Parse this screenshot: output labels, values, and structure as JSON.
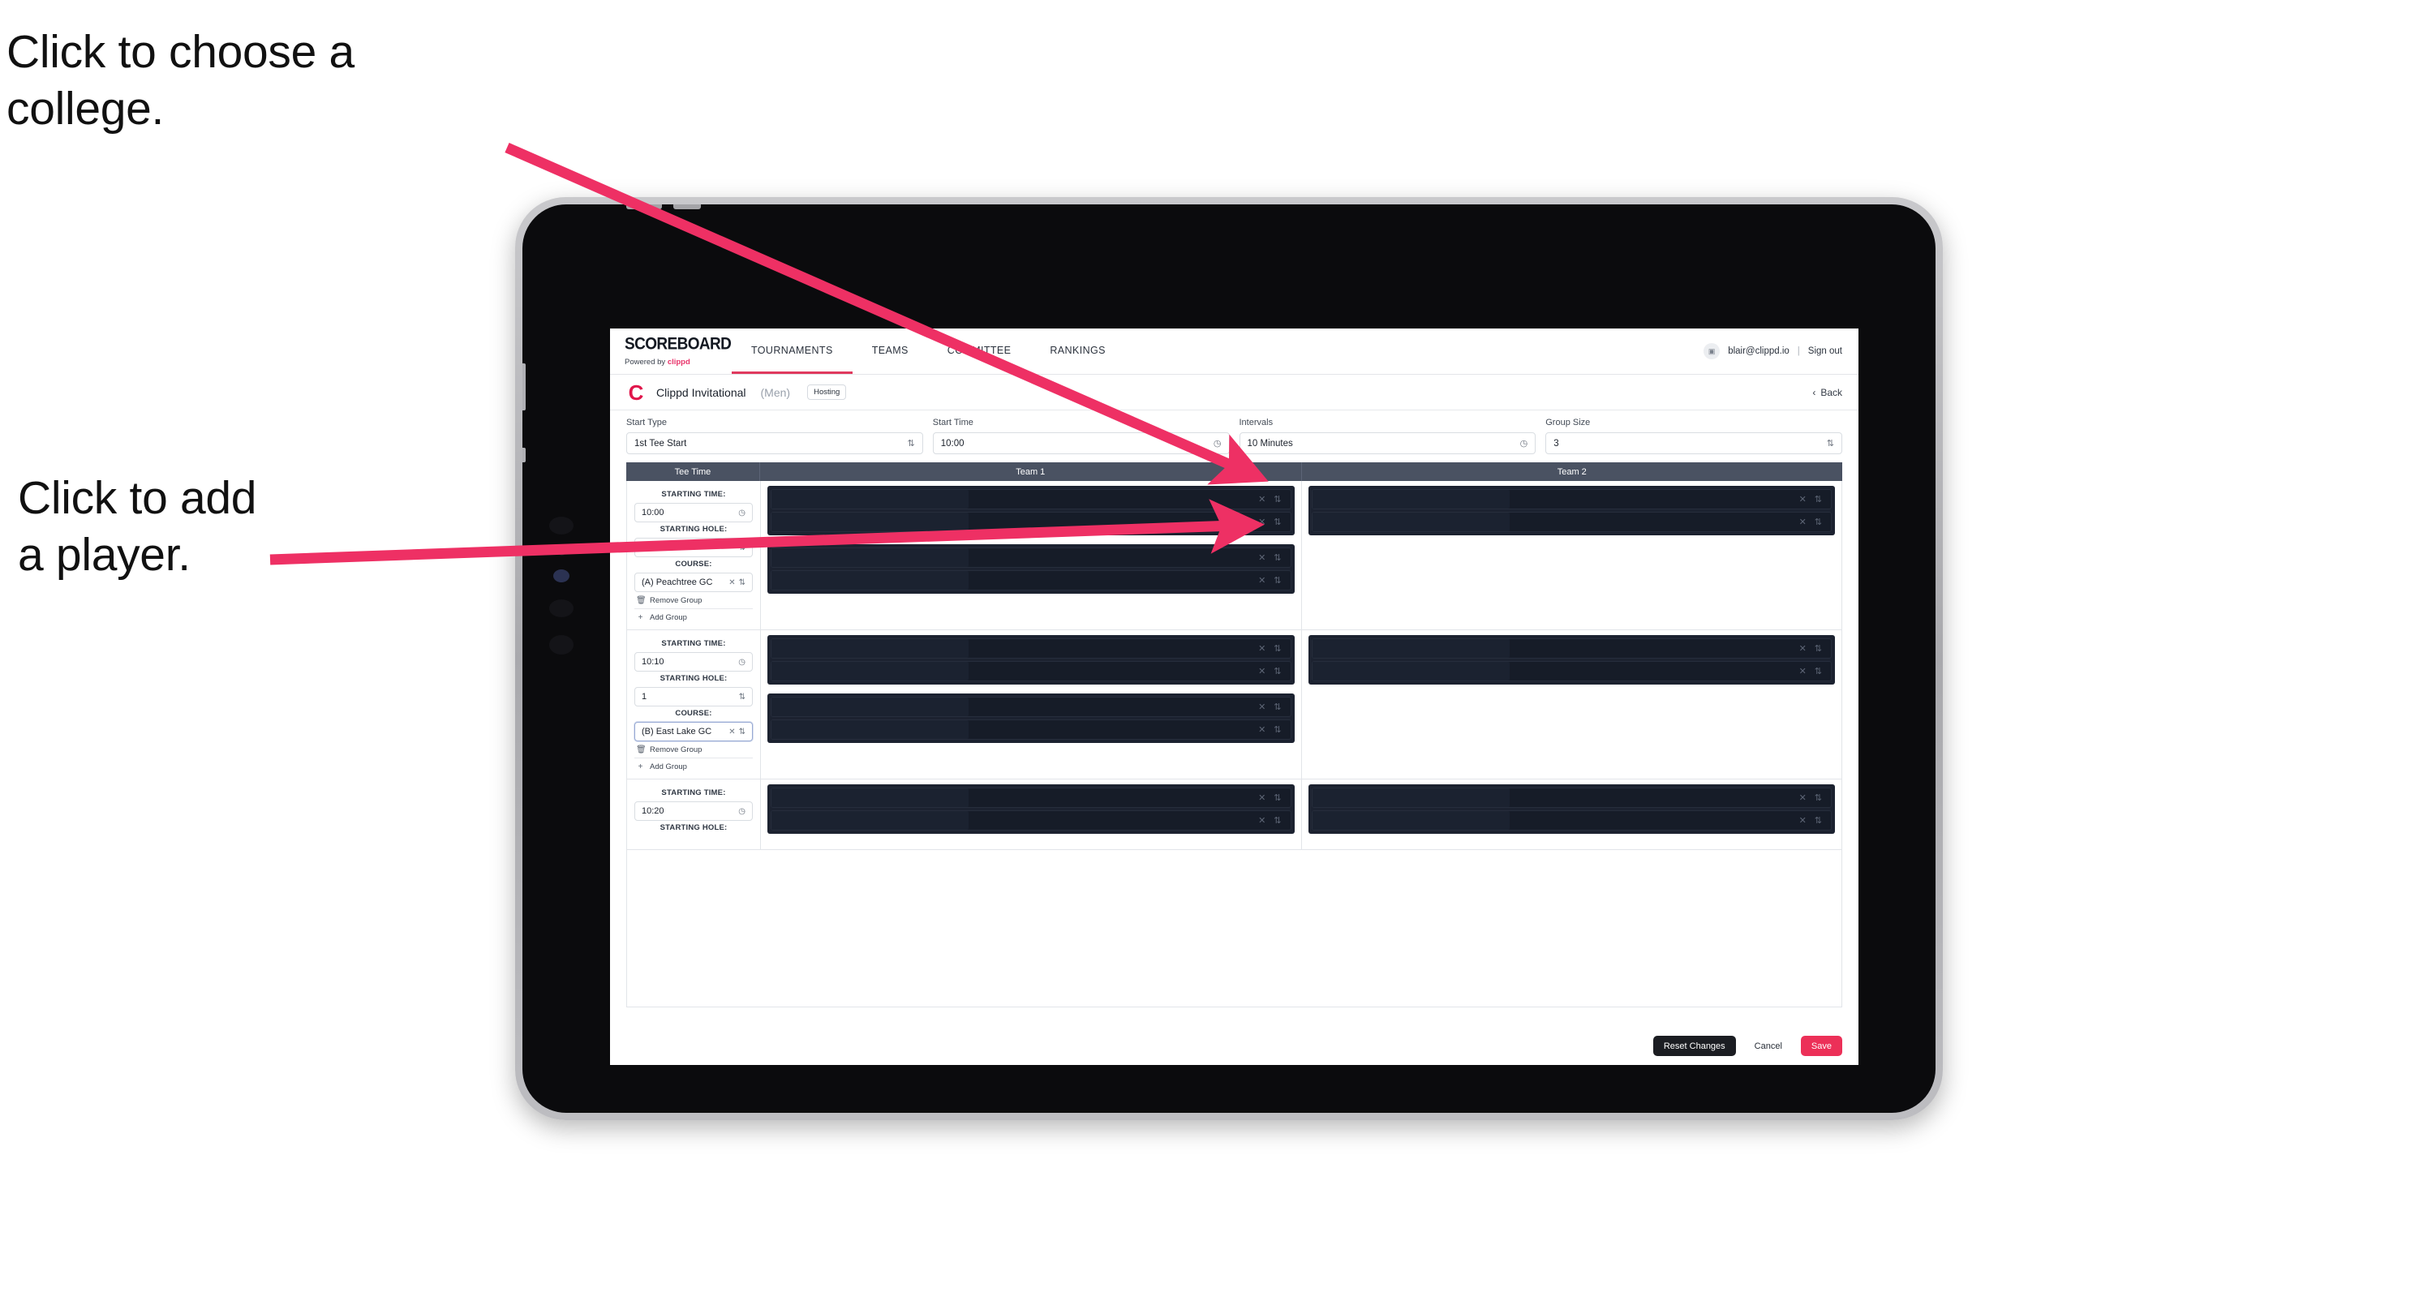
{
  "annotations": {
    "college": "Click to choose a\ncollege.",
    "player": "Click to add\na player."
  },
  "colors": {
    "accent_pink": "#e8336a",
    "save_pink": "#ec3058",
    "arrow_pink": "#ee3064",
    "table_header": "#4a5262",
    "redacted_block": "#1c2230"
  },
  "nav": {
    "brand_title": "SCOREBOARD",
    "brand_sub_prefix": "Powered by ",
    "brand_sub_accent": "clippd",
    "tabs": [
      {
        "label": "TOURNAMENTS",
        "active": true
      },
      {
        "label": "TEAMS",
        "active": false
      },
      {
        "label": "COMMITTEE",
        "active": false
      },
      {
        "label": "RANKINGS",
        "active": false
      }
    ],
    "avatar_icon": "user-avatar-icon",
    "user_email": "blair@clippd.io",
    "separator": "|",
    "sign_out": "Sign out"
  },
  "tournament_header": {
    "logo_letter": "C",
    "name": "Clippd Invitational",
    "gender": "(Men)",
    "badge": "Hosting",
    "back_chevron": "‹",
    "back_label": "Back"
  },
  "form": {
    "fields": [
      {
        "label": "Start Type",
        "value": "1st Tee Start",
        "adorn": "stepper-icon",
        "adorn_glyph": "⇅"
      },
      {
        "label": "Start Time",
        "value": "10:00",
        "adorn": "clock-icon",
        "adorn_glyph": "◷"
      },
      {
        "label": "Intervals",
        "value": "10 Minutes",
        "adorn": "clock-icon",
        "adorn_glyph": "◷"
      },
      {
        "label": "Group Size",
        "value": "3",
        "adorn": "stepper-icon",
        "adorn_glyph": "⇅"
      }
    ]
  },
  "table": {
    "headers": {
      "tee_time": "Tee Time",
      "team1": "Team 1",
      "team2": "Team 2"
    },
    "labels": {
      "starting_time": "STARTING TIME:",
      "starting_hole": "STARTING HOLE:",
      "course": "COURSE:",
      "remove_group": "Remove Group",
      "add_group": "Add Group",
      "remove_icon": "trash-icon",
      "add_icon": "plus-icon",
      "clear_icon": "close-x-icon",
      "stepper_icon": "stepper-icon",
      "clock_icon": "clock-icon"
    },
    "groups": [
      {
        "starting_time": "10:00",
        "starting_hole": "1",
        "course": "(A) Peachtree GC",
        "course_focused": false,
        "team1_blocks": [
          {
            "rows": 2
          },
          {
            "rows": 2
          }
        ],
        "team2_blocks": [
          {
            "rows": 2
          }
        ]
      },
      {
        "starting_time": "10:10",
        "starting_hole": "1",
        "course": "(B) East Lake GC",
        "course_focused": true,
        "team1_blocks": [
          {
            "rows": 2
          },
          {
            "rows": 2
          }
        ],
        "team2_blocks": [
          {
            "rows": 2
          }
        ]
      },
      {
        "starting_time": "10:20",
        "starting_hole": "",
        "course": "",
        "course_focused": false,
        "team1_blocks": [
          {
            "rows": 2
          }
        ],
        "team2_blocks": [
          {
            "rows": 2
          }
        ],
        "partial": true
      }
    ]
  },
  "footer": {
    "reset": "Reset Changes",
    "cancel": "Cancel",
    "save": "Save"
  }
}
